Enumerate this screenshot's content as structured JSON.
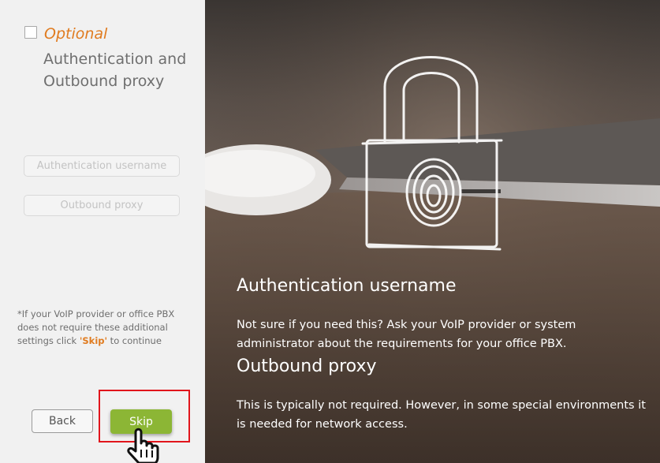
{
  "left": {
    "optional_label": "Optional",
    "section_title": "Authentication and Outbound proxy",
    "auth_placeholder": "Authentication username",
    "proxy_placeholder": "Outbound proxy",
    "note_before": "*If your VoIP provider or office PBX does not require these additional settings click ",
    "note_skip": "'Skip'",
    "note_after": " to continue",
    "back_label": "Back",
    "skip_label": "Skip"
  },
  "right": {
    "auth_title": "Authentication username",
    "auth_text": "Not sure if you need this? Ask your VoIP provider or system administrator about the requirements for your office PBX.",
    "proxy_title": "Outbound proxy",
    "proxy_text": "This is typically not required. However, in some special environments it is needed for network access."
  },
  "colors": {
    "accent_orange": "#e07b1f",
    "skip_green": "#8cb635",
    "highlight_red": "#e1151c"
  },
  "icons": [
    "checkbox-icon",
    "padlock-fingerprint-icon",
    "hand-pointer-icon"
  ]
}
